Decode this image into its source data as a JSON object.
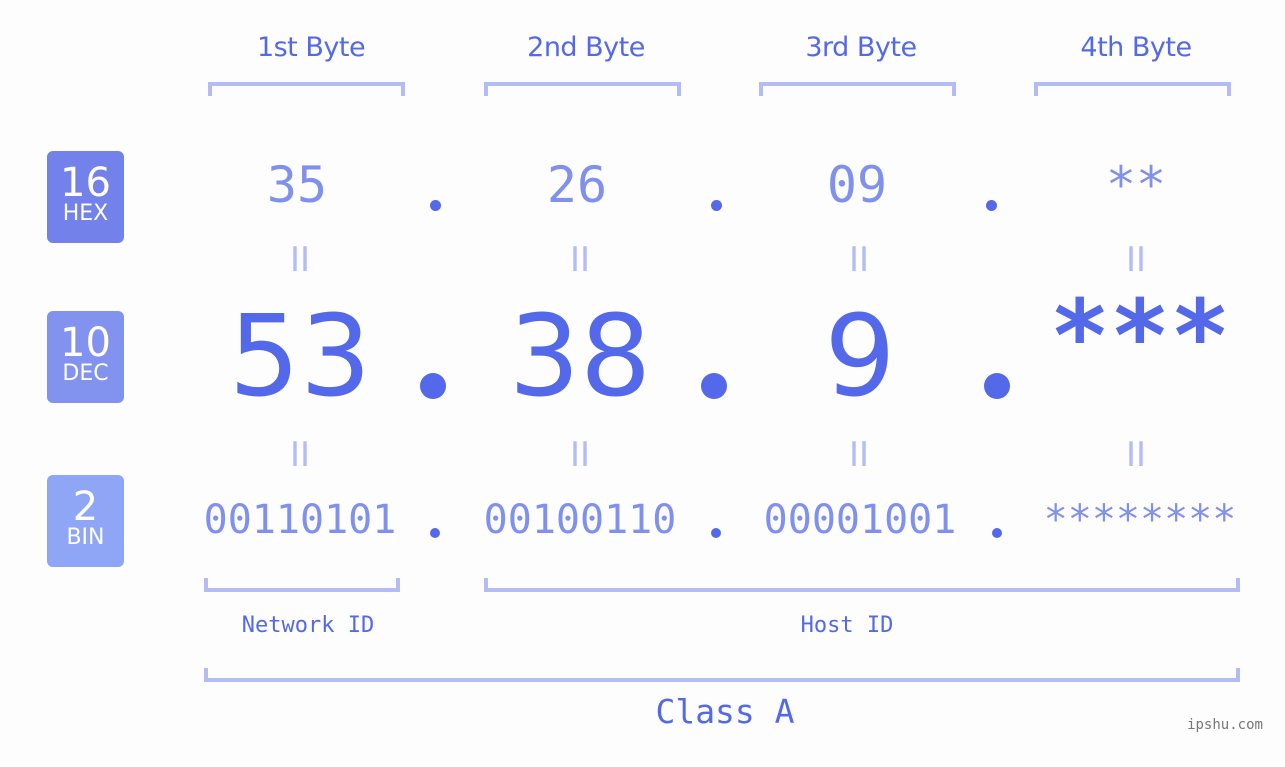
{
  "bytes": [
    {
      "label": "1st Byte",
      "hex": "35",
      "dec": "53",
      "bin": "00110101"
    },
    {
      "label": "2nd Byte",
      "hex": "26",
      "dec": "38",
      "bin": "00100110"
    },
    {
      "label": "3rd Byte",
      "hex": "09",
      "dec": "9",
      "bin": "00001001"
    },
    {
      "label": "4th Byte",
      "hex": "**",
      "dec": "***",
      "bin": "********"
    }
  ],
  "badges": {
    "hex": {
      "num": "16",
      "label": "HEX",
      "color": "#7381ea"
    },
    "dec": {
      "num": "10",
      "label": "DEC",
      "color": "#8292ef"
    },
    "bin": {
      "num": "2",
      "label": "BIN",
      "color": "#8fa5f6"
    }
  },
  "equals_sign": "II",
  "network_id_label": "Network ID",
  "host_id_label": "Host ID",
  "class_label": "Class A",
  "watermark": "ipshu.com",
  "colors": {
    "primary_text": "#5468ea",
    "secondary_text": "#8090ee",
    "bracket": "#b3bcf7",
    "background": "#fcfdfc"
  }
}
